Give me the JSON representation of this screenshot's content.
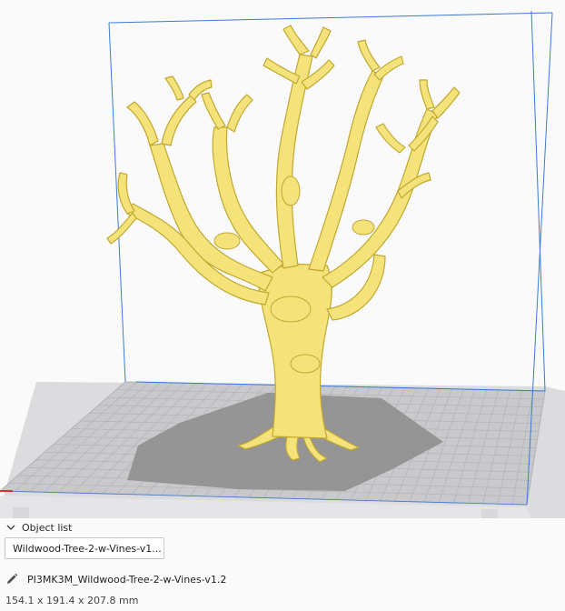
{
  "viewport": {
    "colors": {
      "background": "#fafafa",
      "build_volume_lines": "#3a7bd5",
      "build_plate": "#c9c9cc",
      "grid_lines": "#aeb0b5",
      "model_fill": "#f4e27a",
      "model_stroke": "#c2a82e",
      "model_shadow": "#8c8c8c",
      "x_axis": "#e0302a"
    }
  },
  "object_list": {
    "header_label": "Object list",
    "collapse_icon": "chevron-down-icon",
    "items": [
      {
        "label": "Wildwood-Tree-2-w-Vines-v1..."
      }
    ]
  },
  "job": {
    "edit_icon": "pencil-icon",
    "name": "PI3MK3M_Wildwood-Tree-2-w-Vines-v1.2",
    "dimensions": "154.1 x 191.4 x 207.8 mm"
  }
}
